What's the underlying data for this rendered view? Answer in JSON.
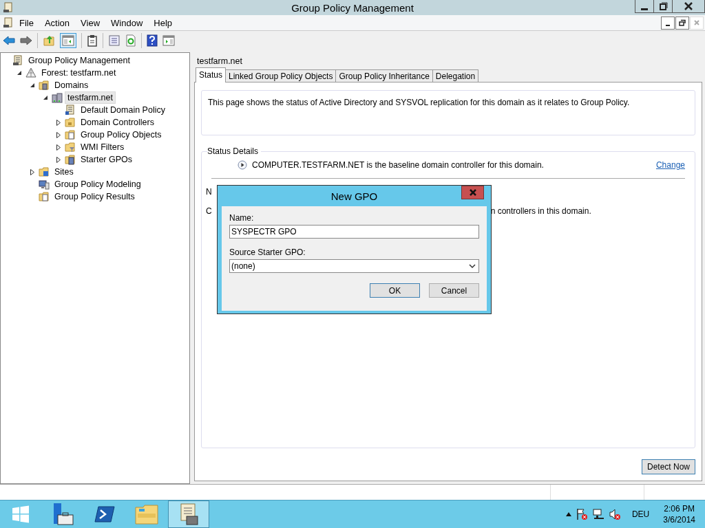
{
  "window": {
    "title": "Group Policy Management"
  },
  "menu": [
    "File",
    "Action",
    "View",
    "Window",
    "Help"
  ],
  "toolbar": [
    {
      "kind": "back",
      "disabled": false
    },
    {
      "kind": "forward",
      "disabled": false
    },
    {
      "kind": "sep"
    },
    {
      "kind": "up"
    },
    {
      "kind": "pane",
      "selected": true
    },
    {
      "kind": "sep"
    },
    {
      "kind": "clipboard"
    },
    {
      "kind": "sep"
    },
    {
      "kind": "list"
    },
    {
      "kind": "refresh"
    },
    {
      "kind": "sep"
    },
    {
      "kind": "help"
    },
    {
      "kind": "action-pane"
    }
  ],
  "tree": [
    {
      "label": "Group Policy Management",
      "kind": "root",
      "selected": false,
      "children": [
        {
          "label": "Forest: testfarm.net",
          "kind": "forest",
          "selected": false,
          "expanded": true,
          "children": [
            {
              "label": "Domains",
              "kind": "folder-servers",
              "selected": false,
              "expanded": true,
              "children": [
                {
                  "label": "testfarm.net",
                  "kind": "domain",
                  "selected": true,
                  "expanded": true,
                  "children": [
                    {
                      "label": "Default Domain Policy",
                      "kind": "gpo-link",
                      "selected": false
                    },
                    {
                      "label": "Domain Controllers",
                      "kind": "ou",
                      "selected": false,
                      "expanded": false
                    },
                    {
                      "label": "Group Policy Objects",
                      "kind": "folder-doc",
                      "selected": false,
                      "expanded": false
                    },
                    {
                      "label": "WMI Filters",
                      "kind": "folder-filter",
                      "selected": false,
                      "expanded": false
                    },
                    {
                      "label": "Starter GPOs",
                      "kind": "folder-starter",
                      "selected": false,
                      "expanded": false
                    }
                  ]
                }
              ]
            },
            {
              "label": "Sites",
              "kind": "folder-sites",
              "selected": false,
              "expanded": false
            },
            {
              "label": "Group Policy Modeling",
              "kind": "modeling",
              "selected": false
            },
            {
              "label": "Group Policy Results",
              "kind": "results",
              "selected": false
            }
          ]
        }
      ]
    }
  ],
  "content": {
    "header": "testfarm.net",
    "tabs": [
      {
        "label": "Status",
        "selected": true
      },
      {
        "label": "Linked Group Policy Objects",
        "selected": false
      },
      {
        "label": "Group Policy Inheritance",
        "selected": false
      },
      {
        "label": "Delegation",
        "selected": false
      }
    ],
    "intro": "This page shows the status of Active Directory and SYSVOL replication for this domain as it relates to Group Policy.",
    "status_details": {
      "title": "Status Details",
      "baseline": "COMPUTER.TESTFARM.NET is the baseline domain controller for this domain.",
      "change_link": "Change",
      "line_1": "N",
      "line_2_start": "C",
      "line_2_end": "n controllers in this domain."
    },
    "detect_button": "Detect Now"
  },
  "dialog": {
    "title": "New GPO",
    "name_label": "Name:",
    "name_value": "SYSPECTR GPO",
    "source_label": "Source Starter GPO:",
    "source_value": "(none)",
    "ok": "OK",
    "cancel": "Cancel"
  },
  "taskbar": {
    "apps": [
      {
        "kind": "start",
        "selected": false
      },
      {
        "kind": "server-manager",
        "selected": false
      },
      {
        "kind": "powershell",
        "selected": false
      },
      {
        "kind": "explorer",
        "selected": false
      },
      {
        "kind": "gpm",
        "selected": true
      }
    ],
    "language": "DEU",
    "time": "2:06 PM",
    "date": "3/6/2014"
  }
}
